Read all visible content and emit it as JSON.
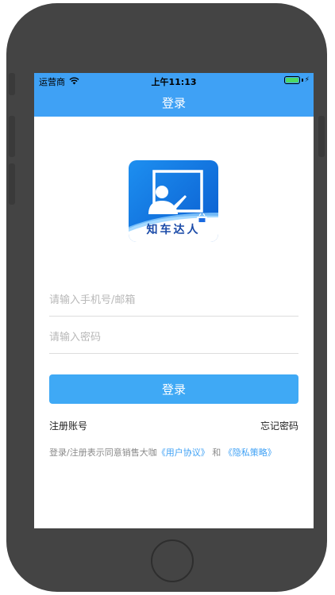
{
  "statusbar": {
    "carrier": "运营商",
    "time": "上午11:13",
    "battery_level": 1.0
  },
  "navbar": {
    "title": "登录"
  },
  "logo": {
    "text": "知车达人"
  },
  "form": {
    "phone_placeholder": "请输入手机号/邮箱",
    "password_placeholder": "请输入密码",
    "login_label": "登录"
  },
  "links": {
    "register": "注册账号",
    "forgot": "忘记密码"
  },
  "agreement": {
    "prefix": "登录/注册表示同意销售大咖",
    "user_agreement": "《用户协议》",
    "and": "和",
    "privacy": "《隐私策略》"
  },
  "colors": {
    "accent": "#3fa1f5",
    "button": "#3fa9f5",
    "frame": "#444444"
  },
  "icons": [
    "wifi-icon",
    "battery-icon",
    "charging-icon",
    "teacher-board-icon",
    "tv-icon"
  ]
}
